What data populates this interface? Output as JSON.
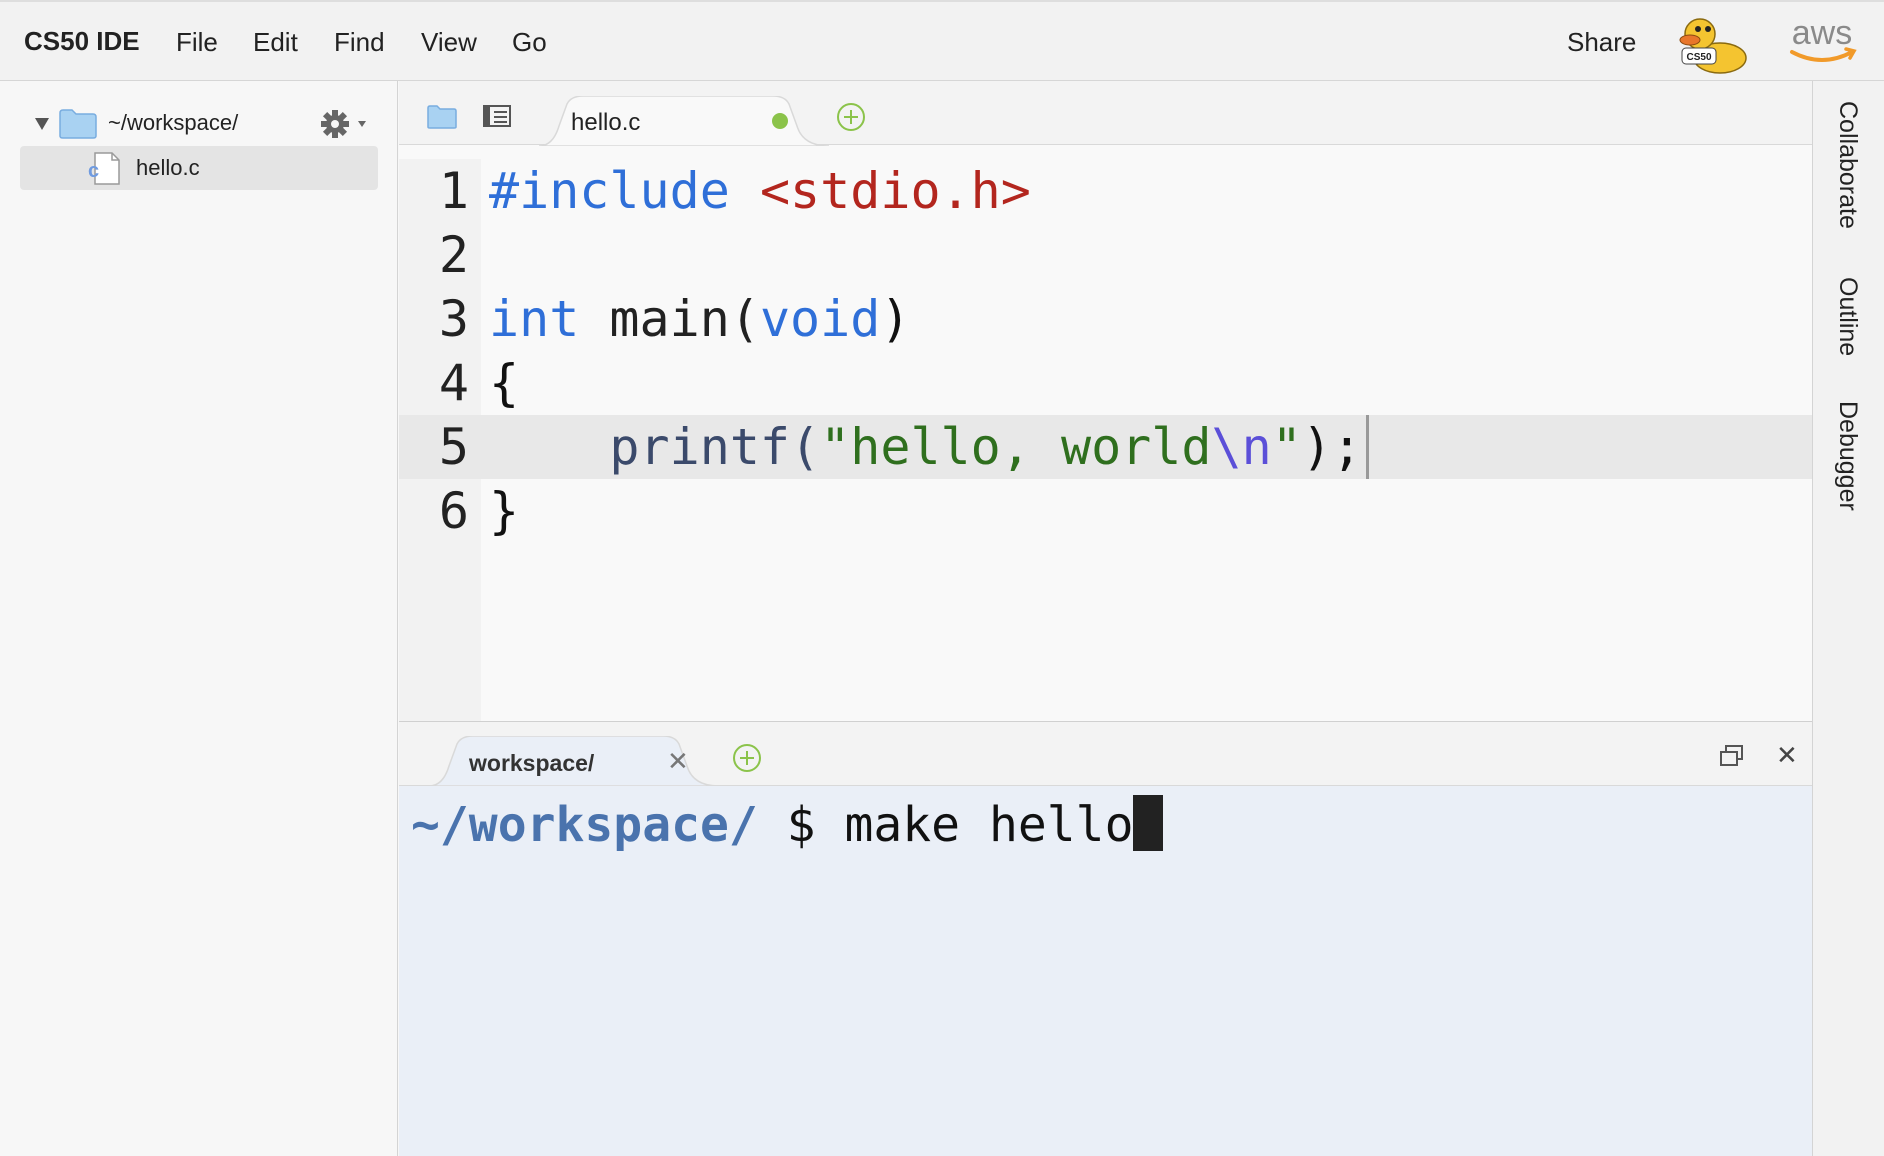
{
  "menubar": {
    "brand": "CS50 IDE",
    "items": [
      "File",
      "Edit",
      "Find",
      "View",
      "Go"
    ],
    "share_label": "Share",
    "duck_badge": "CS50",
    "aws_label": "aws"
  },
  "sidebar": {
    "root_label": "~/workspace/",
    "files": [
      {
        "label": "hello.c",
        "icon": "c-file-icon",
        "selected": true
      }
    ]
  },
  "editor": {
    "tab_label": "hello.c",
    "tab_modified": true,
    "active_line": 5,
    "lines": [
      {
        "num": "1",
        "tokens": [
          {
            "t": "#include ",
            "c": "tok-pre"
          },
          {
            "t": "<stdio.h>",
            "c": "tok-inc"
          }
        ]
      },
      {
        "num": "2",
        "tokens": []
      },
      {
        "num": "3",
        "tokens": [
          {
            "t": "int",
            "c": "tok-kw"
          },
          {
            "t": " main(",
            "c": "tok-fn"
          },
          {
            "t": "void",
            "c": "tok-kw"
          },
          {
            "t": ")",
            "c": "tok-punc"
          }
        ]
      },
      {
        "num": "4",
        "tokens": [
          {
            "t": "{",
            "c": "tok-punc"
          }
        ]
      },
      {
        "num": "5",
        "tokens": [
          {
            "t": "    printf(",
            "c": "tok-call"
          },
          {
            "t": "\"hello, world",
            "c": "tok-str"
          },
          {
            "t": "\\n",
            "c": "tok-esc"
          },
          {
            "t": "\"",
            "c": "tok-str"
          },
          {
            "t": ");",
            "c": "tok-punc"
          }
        ]
      },
      {
        "num": "6",
        "tokens": [
          {
            "t": "}",
            "c": "tok-punc"
          }
        ]
      }
    ]
  },
  "terminal": {
    "tab_label": "workspace/",
    "prompt": "~/workspace/",
    "dollar": " $ ",
    "command": "make hello"
  },
  "right_tabs": [
    "Collaborate",
    "Outline",
    "Debugger"
  ],
  "colors": {
    "accent_green": "#8bc34a",
    "prompt_blue": "#4a73ad",
    "keyword_blue": "#2f6fd8",
    "include_red": "#b3261e",
    "string_green": "#2f6f1e"
  }
}
